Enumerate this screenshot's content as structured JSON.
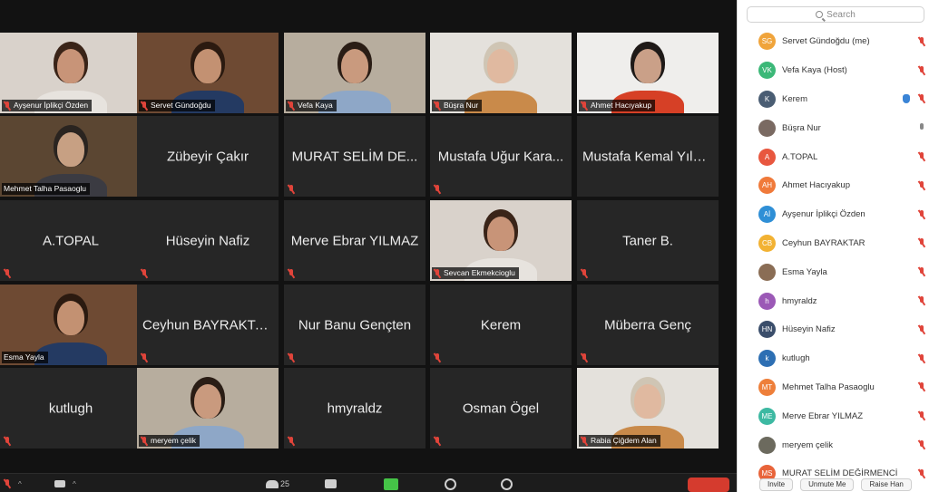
{
  "gallery": {
    "tiles": [
      {
        "name": "Ayşenur İplikçi Özden",
        "video": true,
        "muted": true
      },
      {
        "name": "Servet Gündoğdu",
        "video": true,
        "muted": true
      },
      {
        "name": "Vefa Kaya",
        "video": true,
        "muted": true
      },
      {
        "name": "Büşra Nur",
        "video": true,
        "muted": true,
        "speaking": true
      },
      {
        "name": "Ahmet Hacıyakup",
        "video": true,
        "muted": true
      },
      {
        "name": "Mehmet Talha Pasaoglu",
        "video": true,
        "muted": false
      },
      {
        "name": "Zübeyir Çakır",
        "video": false,
        "muted": false
      },
      {
        "name": "MURAT SELİM DE...",
        "video": false,
        "muted": true
      },
      {
        "name": "Mustafa Uğur Kara...",
        "video": false,
        "muted": true
      },
      {
        "name": "Mustafa Kemal Yılmaz",
        "video": false,
        "muted": false
      },
      {
        "name": "A.TOPAL",
        "video": false,
        "muted": true
      },
      {
        "name": "Hüseyin Nafiz",
        "video": false,
        "muted": true
      },
      {
        "name": "Merve Ebrar YILMAZ",
        "video": false,
        "muted": true
      },
      {
        "name": "Sevcan Ekmekcioglu",
        "video": true,
        "muted": true
      },
      {
        "name": "Taner B.",
        "video": false,
        "muted": true
      },
      {
        "name": "Esma Yayla",
        "video": true,
        "muted": false
      },
      {
        "name": "Ceyhun BAYRAKTAR",
        "video": false,
        "muted": true
      },
      {
        "name": "Nur Banu Gençten",
        "video": false,
        "muted": true
      },
      {
        "name": "Kerem",
        "video": false,
        "muted": true
      },
      {
        "name": "Müberra Genç",
        "video": false,
        "muted": true
      },
      {
        "name": "kutlugh",
        "video": false,
        "muted": true
      },
      {
        "name": "meryem çelik",
        "video": true,
        "muted": true
      },
      {
        "name": "hmyraldz",
        "video": false,
        "muted": true
      },
      {
        "name": "Osman Ögel",
        "video": false,
        "muted": true
      },
      {
        "name": "Rabia Çiğdem Alan",
        "video": true,
        "muted": true
      }
    ]
  },
  "toolbar": {
    "participants_count": "25"
  },
  "panel": {
    "search_placeholder": "Search",
    "participants": [
      {
        "initials": "SG",
        "name": "Servet Gündoğdu (me)",
        "color": "#f0a43b",
        "status": "muted"
      },
      {
        "initials": "VK",
        "name": "Vefa Kaya (Host)",
        "color": "#3cb878",
        "status": "muted"
      },
      {
        "initials": "K",
        "name": "Kerem",
        "color": "#4a5d73",
        "status": "muted",
        "hand": true
      },
      {
        "initials": "",
        "name": "Büşra Nur",
        "color": "#7a6a62",
        "status": "unmuted"
      },
      {
        "initials": "A",
        "name": "A.TOPAL",
        "color": "#e8573f",
        "status": "muted"
      },
      {
        "initials": "AH",
        "name": "Ahmet Hacıyakup",
        "color": "#f07a3a",
        "status": "muted"
      },
      {
        "initials": "Aİ",
        "name": "Ayşenur İplikçi Özden",
        "color": "#2f8fd6",
        "status": "muted"
      },
      {
        "initials": "CB",
        "name": "Ceyhun BAYRAKTAR",
        "color": "#f2b233",
        "status": "muted-red"
      },
      {
        "initials": "",
        "name": "Esma Yayla",
        "color": "#8a6d55",
        "status": "muted"
      },
      {
        "initials": "h",
        "name": "hmyraldz",
        "color": "#9b59b6",
        "status": "muted"
      },
      {
        "initials": "HN",
        "name": "Hüseyin Nafiz",
        "color": "#3b4e6b",
        "status": "muted"
      },
      {
        "initials": "k",
        "name": "kutlugh",
        "color": "#2d6fb3",
        "status": "muted"
      },
      {
        "initials": "MT",
        "name": "Mehmet Talha Pasaoglu",
        "color": "#ee7f3a",
        "status": "muted"
      },
      {
        "initials": "ME",
        "name": "Merve Ebrar YILMAZ",
        "color": "#3db9a2",
        "status": "muted"
      },
      {
        "initials": "",
        "name": "meryem çelik",
        "color": "#6c6a5e",
        "status": "muted"
      },
      {
        "initials": "MS",
        "name": "MURAT SELİM DEĞİRMENCİ",
        "color": "#e8643a",
        "status": "muted"
      }
    ],
    "footer_buttons": [
      "Invite",
      "Unmute Me",
      "Raise Han"
    ]
  }
}
